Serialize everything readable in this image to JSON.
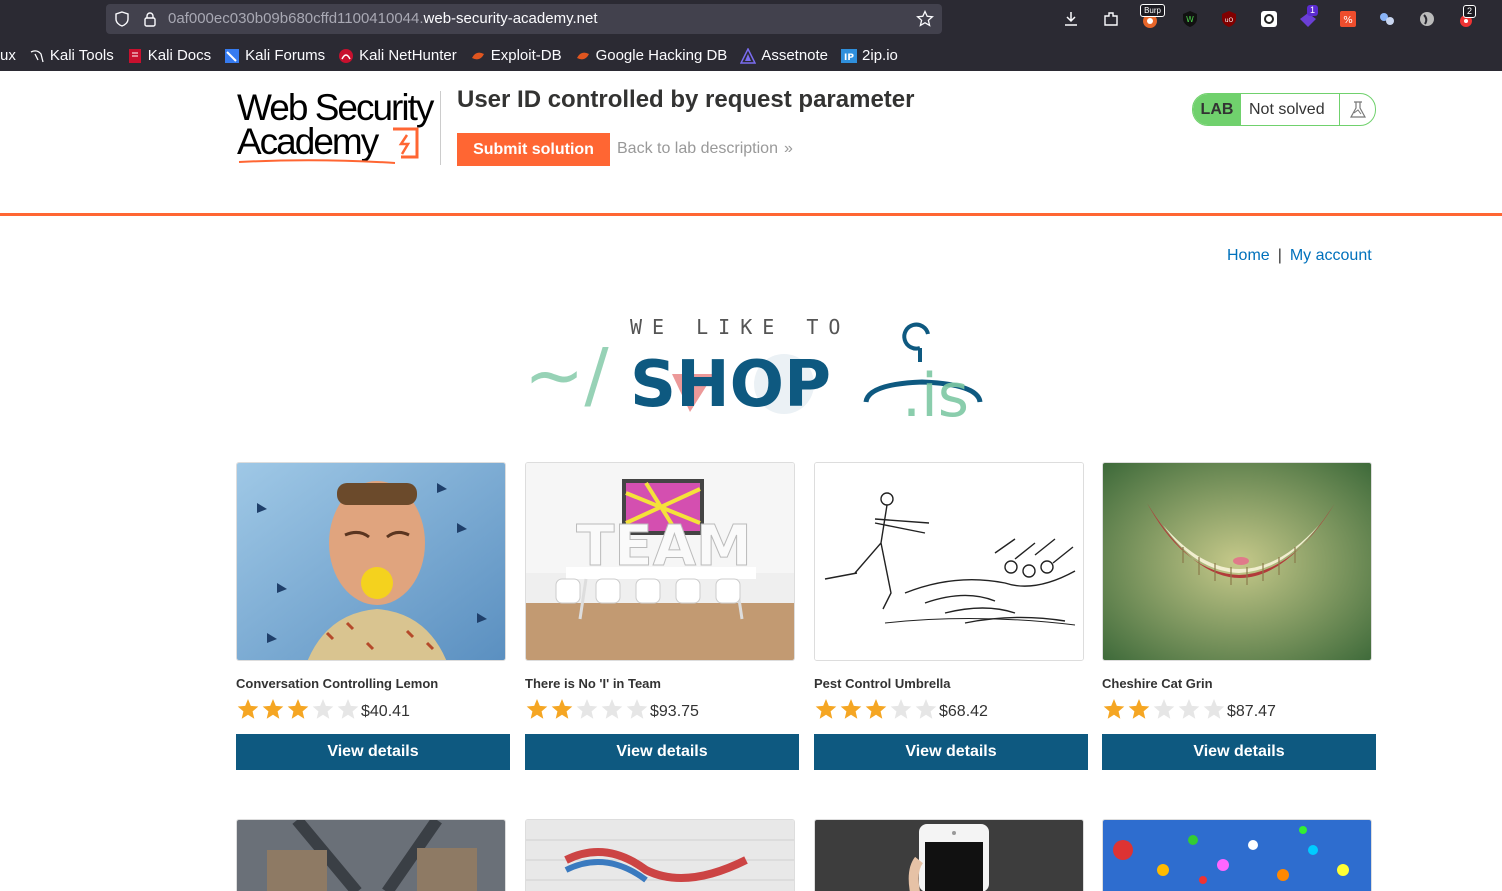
{
  "browser": {
    "url_prefix": "0af000ec030b09b680cffd1100410044.",
    "url_domain": "web-security-academy.net",
    "extensions": [
      "download-icon",
      "extensions-icon",
      "burp-icon",
      "wappalyzer-icon",
      "ublock-icon",
      "hackbar-icon",
      "notification-icon",
      "foxyproxy-icon",
      "multi-account-icon",
      "cookie-icon",
      "badge-icon"
    ],
    "ext_badges": {
      "burp": "Burp",
      "notif": "1",
      "last": "2"
    },
    "bookmarks": [
      {
        "label": "ux",
        "icon": "none"
      },
      {
        "label": "Kali Tools",
        "icon": "kali-icon"
      },
      {
        "label": "Kali Docs",
        "icon": "kali-docs-icon"
      },
      {
        "label": "Kali Forums",
        "icon": "kali-forums-icon"
      },
      {
        "label": "Kali NetHunter",
        "icon": "nethunter-icon"
      },
      {
        "label": "Exploit-DB",
        "icon": "exploitdb-icon"
      },
      {
        "label": "Google Hacking DB",
        "icon": "ghdb-icon"
      },
      {
        "label": "Assetnote",
        "icon": "assetnote-icon"
      },
      {
        "label": "2ip.io",
        "icon": "2ip-icon"
      }
    ]
  },
  "lab": {
    "logo_line1": "Web Security",
    "logo_line2": "Academy",
    "title": "User ID controlled by request parameter",
    "submit_label": "Submit solution",
    "back_label": "Back to lab description",
    "back_chevron": "»",
    "status_tag": "LAB",
    "status_text": "Not solved",
    "colors": {
      "accent": "#ff6633",
      "status_green": "#70d16d",
      "button_blue": "#0e5980",
      "link_blue": "#0071bc"
    }
  },
  "nav": {
    "home": "Home",
    "separator": "|",
    "account": "My account"
  },
  "banner": {
    "line1": "WE LIKE TO",
    "line2": "SHOP",
    "prefix": "~/",
    "suffix": ".is"
  },
  "products": [
    {
      "name": "Conversation Controlling Lemon",
      "rating": 3,
      "price": "$40.41",
      "button": "View details"
    },
    {
      "name": "There is No 'I' in Team",
      "rating": 2,
      "price": "$93.75",
      "button": "View details"
    },
    {
      "name": "Pest Control Umbrella",
      "rating": 3,
      "price": "$68.42",
      "button": "View details"
    },
    {
      "name": "Cheshire Cat Grin",
      "rating": 2,
      "price": "$87.47",
      "button": "View details"
    }
  ]
}
